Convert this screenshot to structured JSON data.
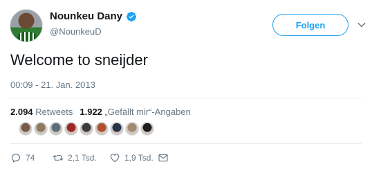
{
  "user": {
    "display_name": "Nounkeu Dany",
    "handle": "@NounkeuD",
    "verified_icon": "verified-badge-icon",
    "avatar_icon": "user-avatar"
  },
  "follow_button": {
    "label": "Folgen",
    "color": "#1da1f2"
  },
  "tweet": {
    "text": "Welcome to sneijder",
    "timestamp": "00:09 - 21. Jan. 2013"
  },
  "stats": {
    "retweets_count": "2.094",
    "retweets_label": "Retweets",
    "likes_count": "1.922",
    "likes_label": "„Gefällt mir“-Angaben"
  },
  "likers": [
    {
      "color": "#7a5a48"
    },
    {
      "color": "#8c7a5c"
    },
    {
      "color": "#5b6e7c"
    },
    {
      "color": "#9c2a2a"
    },
    {
      "color": "#3c3c3c"
    },
    {
      "color": "#b0502e"
    },
    {
      "color": "#27334a"
    },
    {
      "color": "#a08a70"
    },
    {
      "color": "#1e1e1e"
    }
  ],
  "actions": {
    "reply_count": "74",
    "retweet_count": "2,1 Tsd.",
    "like_count": "1,9 Tsd."
  },
  "colors": {
    "text": "#14171a",
    "muted": "#657786",
    "accent": "#1da1f2",
    "border": "#e6ecf0"
  }
}
